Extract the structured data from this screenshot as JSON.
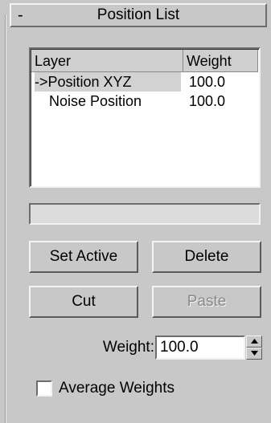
{
  "rollout": {
    "toggle": "-",
    "title": "Position List"
  },
  "layer_list": {
    "columns": [
      "Layer",
      "Weight"
    ],
    "rows": [
      {
        "layer": "->Position XYZ",
        "weight": "100.0",
        "active": true
      },
      {
        "layer": "Noise Position",
        "weight": "100.0",
        "active": false
      }
    ]
  },
  "name_field": {
    "value": ""
  },
  "buttons": {
    "set_active": "Set Active",
    "delete": "Delete",
    "cut": "Cut",
    "paste": "Paste"
  },
  "weight": {
    "label": "Weight:",
    "value": "100.0"
  },
  "average_weights": {
    "label": "Average Weights",
    "checked": false
  },
  "icons": {
    "spin_up": "spinner-up-arrow-icon",
    "spin_down": "spinner-down-arrow-icon"
  }
}
